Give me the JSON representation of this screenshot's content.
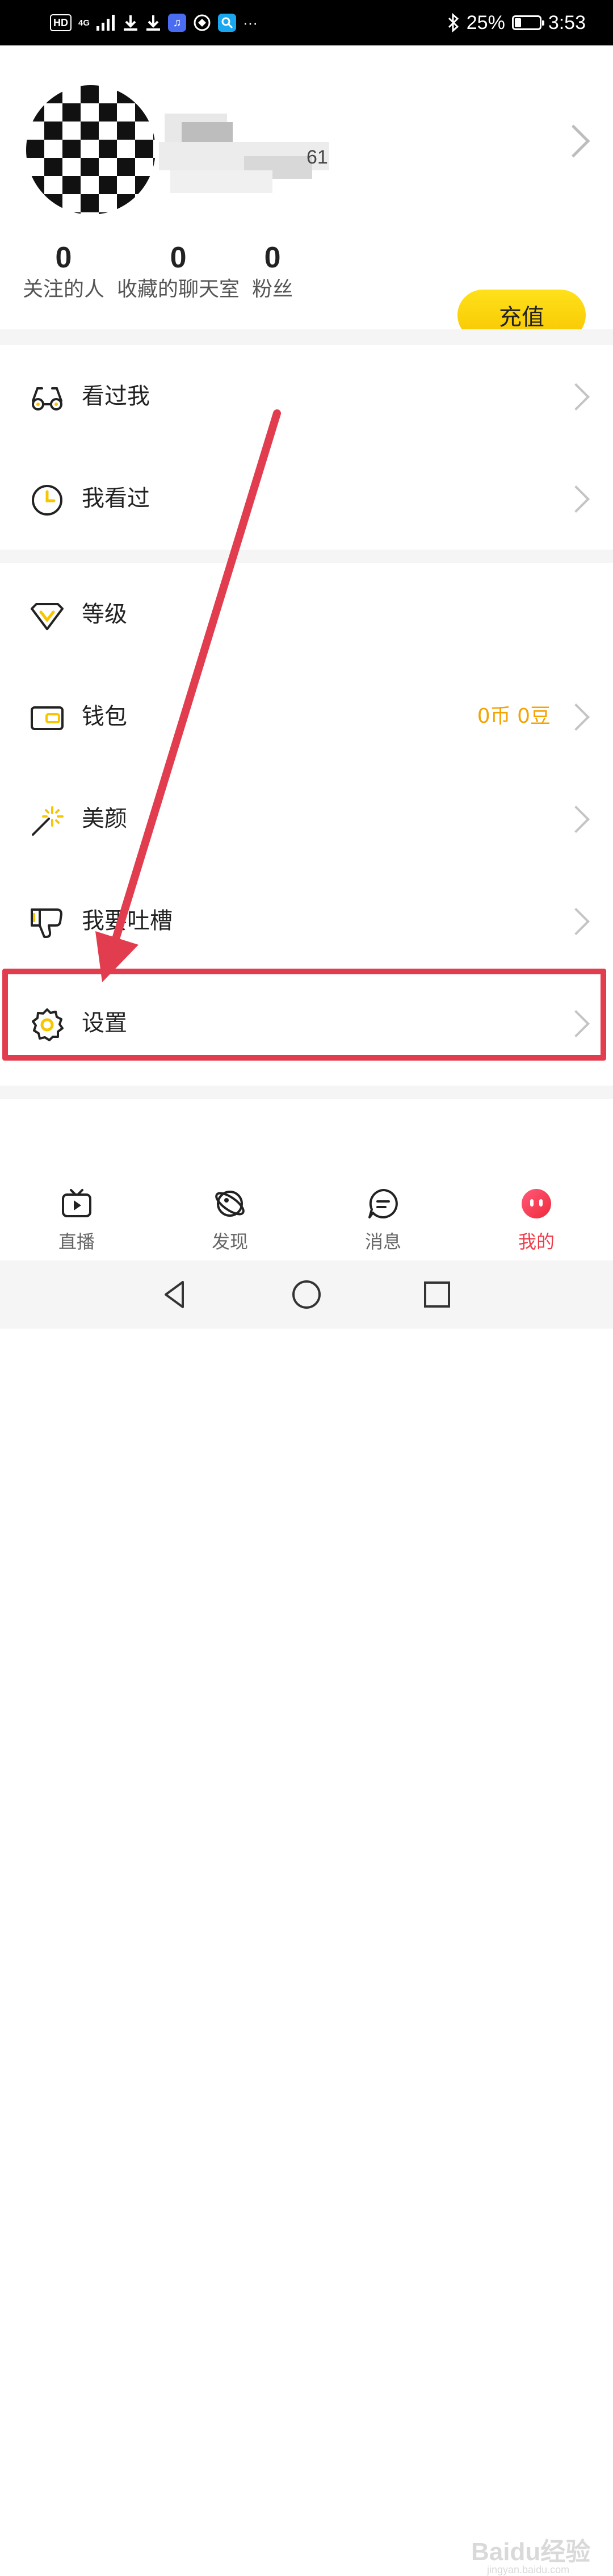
{
  "status_bar": {
    "hd": "HD",
    "network": "4G",
    "battery_percent": "25%",
    "battery_level": 0.25,
    "time": "3:53",
    "more": "···",
    "icons": [
      "download-icon",
      "download-icon",
      "music-app-icon",
      "browser-app-icon",
      "search-app-icon",
      "bluetooth-icon"
    ]
  },
  "profile": {
    "name_visible_fragment": "61",
    "stats": [
      {
        "value": "0",
        "label": "关注的人"
      },
      {
        "value": "0",
        "label": "收藏的聊天室"
      },
      {
        "value": "0",
        "label": "粉丝"
      }
    ],
    "recharge_label": "充值"
  },
  "menu_section_1": [
    {
      "label": "看过我",
      "icon": "glasses-icon"
    },
    {
      "label": "我看过",
      "icon": "clock-icon"
    }
  ],
  "menu_section_2": [
    {
      "label": "等级",
      "icon": "diamond-level-icon"
    },
    {
      "label": "钱包",
      "icon": "wallet-icon",
      "value": "0币  0豆"
    },
    {
      "label": "美颜",
      "icon": "magic-wand-icon"
    },
    {
      "label": "我要吐槽",
      "icon": "thumbs-down-icon"
    },
    {
      "label": "设置",
      "icon": "gear-icon"
    }
  ],
  "tabs": [
    {
      "label": "直播",
      "icon": "tv-play-icon",
      "active": false
    },
    {
      "label": "发现",
      "icon": "planet-icon",
      "active": false
    },
    {
      "label": "消息",
      "icon": "chat-bubble-icon",
      "active": false
    },
    {
      "label": "我的",
      "icon": "face-avatar-icon",
      "active": true
    }
  ],
  "watermark": {
    "text": "Baidu经验",
    "sub": "jingyan.baidu.com"
  },
  "colors": {
    "accent_yellow": "#f7c600",
    "active_red": "#ef3b4a",
    "annotation_red": "#e23d4f",
    "value_orange": "#f5a300"
  }
}
